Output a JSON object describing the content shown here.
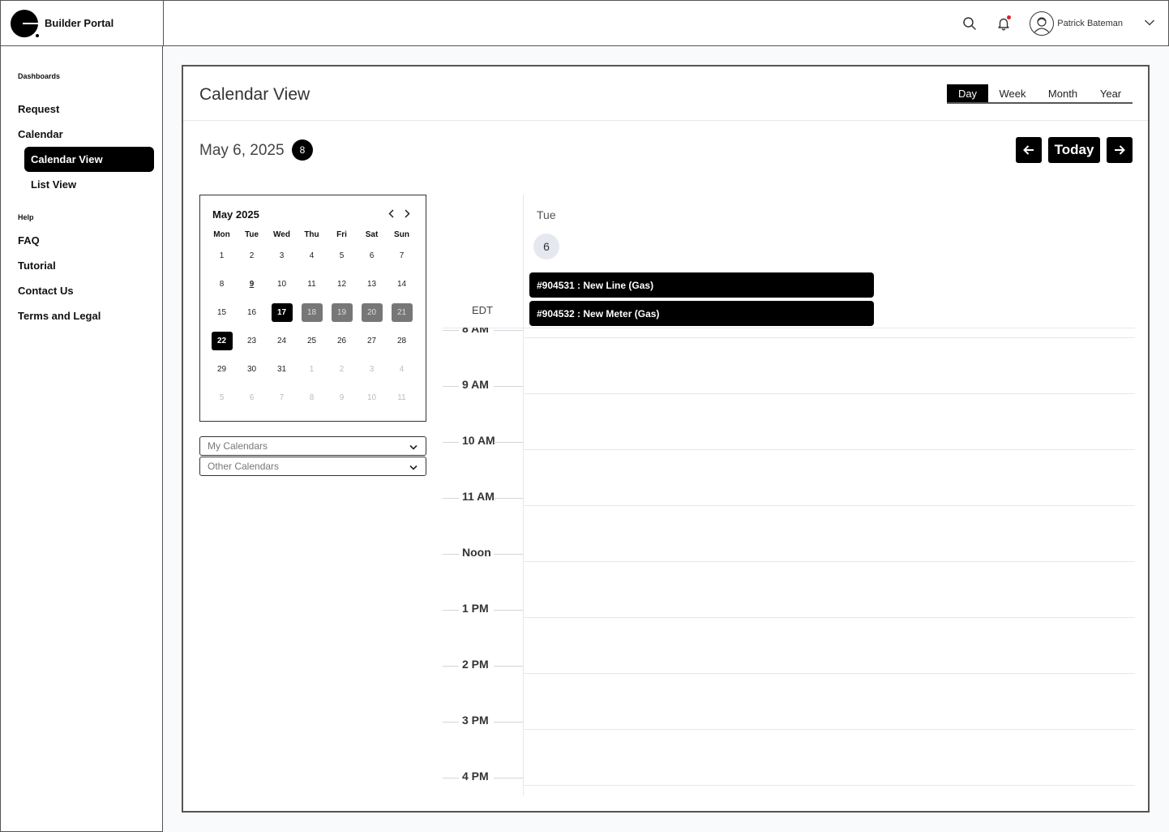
{
  "header": {
    "brand": "Builder Portal",
    "user_name": "Patrick Bateman",
    "icons": {
      "search": "search-icon",
      "notifications": "bell-icon",
      "user_menu": "chevron-down-icon"
    },
    "notification_color": "#e11d2e"
  },
  "sidebar": {
    "sections": [
      {
        "label": "Dashboards"
      },
      {
        "label": "Help"
      }
    ],
    "items": {
      "request": "Request",
      "calendar": "Calendar",
      "calendar_view": "Calendar View",
      "list_view": "List View",
      "faq": "FAQ",
      "tutorial": "Tutorial",
      "contact_us": "Contact Us",
      "terms": "Terms and Legal"
    },
    "active_item": "Calendar View"
  },
  "main": {
    "title": "Calendar View",
    "view_tabs": [
      {
        "label": "Day",
        "active": true
      },
      {
        "label": "Week",
        "active": false
      },
      {
        "label": "Month",
        "active": false
      },
      {
        "label": "Year",
        "active": false
      }
    ],
    "current_date": "May 6, 2025",
    "date_badge": "8",
    "nav": {
      "today": "Today"
    },
    "mini_calendar": {
      "title": "May 2025",
      "weekdays": [
        "Mon",
        "Tue",
        "Wed",
        "Thu",
        "Fri",
        "Sat",
        "Sun"
      ],
      "weeks": [
        [
          {
            "d": "1"
          },
          {
            "d": "2"
          },
          {
            "d": "3"
          },
          {
            "d": "4"
          },
          {
            "d": "5"
          },
          {
            "d": "6"
          },
          {
            "d": "7"
          }
        ],
        [
          {
            "d": "8"
          },
          {
            "d": "9",
            "s": "underline"
          },
          {
            "d": "10"
          },
          {
            "d": "11"
          },
          {
            "d": "12"
          },
          {
            "d": "13"
          },
          {
            "d": "14"
          }
        ],
        [
          {
            "d": "15"
          },
          {
            "d": "16"
          },
          {
            "d": "17",
            "s": "sel"
          },
          {
            "d": "18",
            "s": "range"
          },
          {
            "d": "19",
            "s": "range"
          },
          {
            "d": "20",
            "s": "range"
          },
          {
            "d": "21",
            "s": "range"
          }
        ],
        [
          {
            "d": "22",
            "s": "sel"
          },
          {
            "d": "23"
          },
          {
            "d": "24"
          },
          {
            "d": "25"
          },
          {
            "d": "26"
          },
          {
            "d": "27"
          },
          {
            "d": "28"
          }
        ],
        [
          {
            "d": "29"
          },
          {
            "d": "30"
          },
          {
            "d": "31"
          },
          {
            "d": "1",
            "s": "muted"
          },
          {
            "d": "2",
            "s": "muted"
          },
          {
            "d": "3",
            "s": "muted"
          },
          {
            "d": "4",
            "s": "muted"
          }
        ],
        [
          {
            "d": "5",
            "s": "muted"
          },
          {
            "d": "6",
            "s": "muted"
          },
          {
            "d": "7",
            "s": "muted"
          },
          {
            "d": "8",
            "s": "muted"
          },
          {
            "d": "9",
            "s": "muted"
          },
          {
            "d": "10",
            "s": "muted"
          },
          {
            "d": "11",
            "s": "muted"
          }
        ]
      ]
    },
    "dropdowns": {
      "my_calendars": "My Calendars",
      "other_calendars": "Other Calendars"
    },
    "day_view": {
      "day_name": "Tue",
      "day_number": "6",
      "timezone": "EDT",
      "events": [
        {
          "label": "#904531 : New Line (Gas)"
        },
        {
          "label": "#904532 : New Meter (Gas)"
        }
      ],
      "hours": [
        "8 AM",
        "9 AM",
        "10 AM",
        "11 AM",
        "Noon",
        "1 PM",
        "2 PM",
        "3 PM",
        "4 PM"
      ]
    }
  }
}
